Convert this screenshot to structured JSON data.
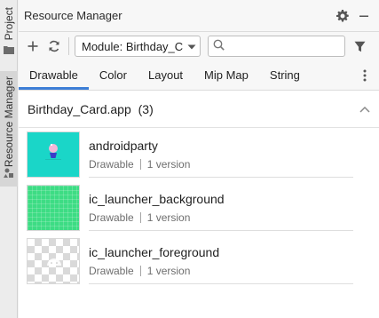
{
  "window": {
    "title": "Resource Manager"
  },
  "side_strip": {
    "project_label": "Project",
    "resource_manager_label": "Resource Manager"
  },
  "toolbar": {
    "module_select_value": "Module: Birthday_C",
    "search_placeholder": "",
    "search_value": ""
  },
  "tabs": [
    {
      "label": "Drawable",
      "active": true
    },
    {
      "label": "Color",
      "active": false
    },
    {
      "label": "Layout",
      "active": false
    },
    {
      "label": "Mip Map",
      "active": false
    },
    {
      "label": "String",
      "active": false
    }
  ],
  "group": {
    "title": "Birthday_Card.app",
    "count": "(3)"
  },
  "resources": [
    {
      "name": "androidparty",
      "type": "Drawable",
      "versions": "1 version",
      "thumbnail": "party-image"
    },
    {
      "name": "ic_launcher_background",
      "type": "Drawable",
      "versions": "1 version",
      "thumbnail": "green-grid"
    },
    {
      "name": "ic_launcher_foreground",
      "type": "Drawable",
      "versions": "1 version",
      "thumbnail": "transparent-checker"
    }
  ],
  "colors": {
    "accent": "#3d7ed6",
    "party_bg": "#1ad6c8",
    "launcher_green": "#3ddc84"
  },
  "icons": {
    "settings": "gear-icon",
    "minimize": "minimize-icon",
    "add": "plus-icon",
    "refresh": "refresh-icon",
    "search": "search-icon",
    "filter": "filter-icon",
    "more": "more-vertical-icon",
    "collapse": "chevron-up-icon"
  }
}
